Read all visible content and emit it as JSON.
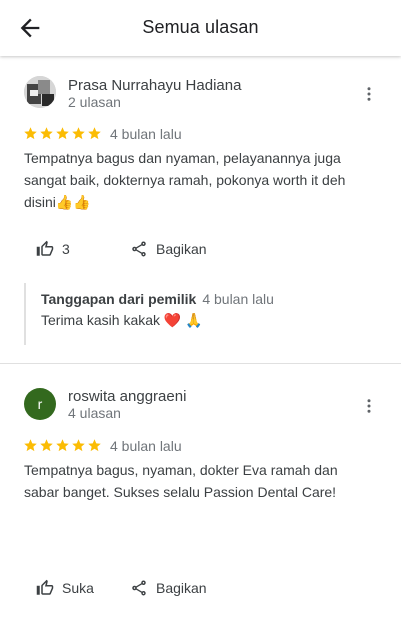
{
  "header": {
    "title": "Semua ulasan"
  },
  "reviews": [
    {
      "name": "Prasa Nurrahayu Hadiana",
      "review_count": "2 ulasan",
      "rating": 5,
      "date": "4 bulan lalu",
      "text": "Tempatnya bagus dan nyaman, pelayanannya juga sangat baik, dokternya ramah, pokonya worth it deh disini👍👍",
      "like_label": "3",
      "share_label": "Bagikan",
      "owner_reply": {
        "label": "Tanggapan dari pemilik",
        "date": "4 bulan lalu",
        "text": "Terima kasih kakak ❤️ 🙏"
      }
    },
    {
      "name": "roswita anggraeni",
      "avatar_letter": "r",
      "review_count": "4 ulasan",
      "rating": 5,
      "date": "4 bulan lalu",
      "text": "Tempatnya bagus, nyaman, dokter Eva ramah dan sabar banget. Sukses selalu Passion Dental Care!",
      "like_label": "Suka",
      "share_label": "Bagikan"
    }
  ],
  "colors": {
    "star": "#fbbc04",
    "avatar_green": "#33691e",
    "divider": "#e0e0e0"
  },
  "icons": [
    "back-arrow-icon",
    "more-vert-icon",
    "star-icon",
    "thumb-up-icon",
    "share-icon"
  ]
}
